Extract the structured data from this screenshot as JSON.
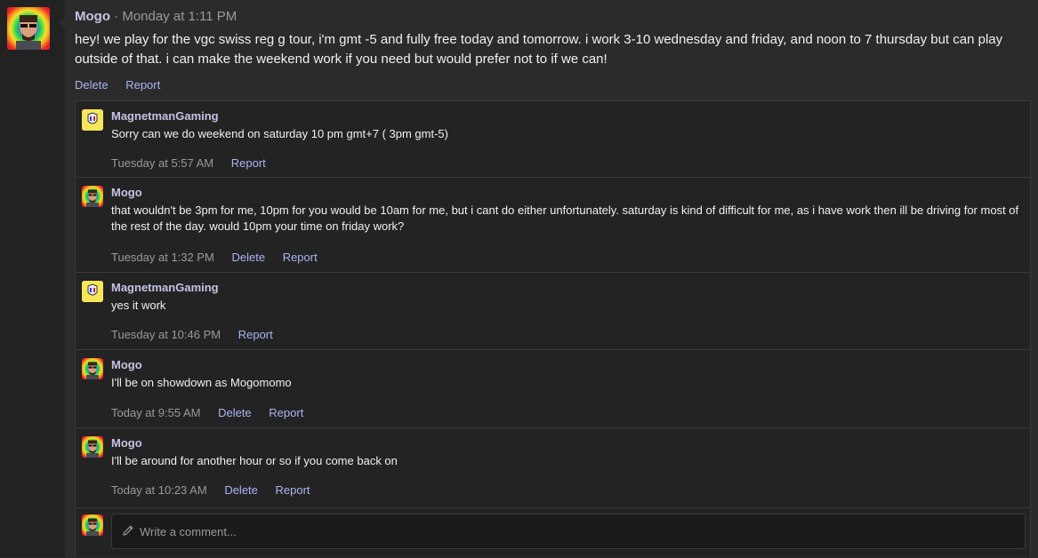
{
  "post": {
    "author": "Mogo",
    "meta": "· Monday at 1:11 PM",
    "body": "hey! we play for the vgc swiss reg g tour, i'm gmt -5 and fully free today and tomorrow. i work 3-10 wednesday and friday, and noon to 7 thursday but can play outside of that. i can make the weekend work if you need but would prefer not to if we can!",
    "actions": [
      "Delete",
      "Report"
    ]
  },
  "replies": [
    {
      "author": "MagnetmanGaming",
      "text": "Sorry can we do weekend on saturday 10 pm gmt+7 ( 3pm gmt-5)",
      "time": "Tuesday at 5:57 AM",
      "actions": [
        "Report"
      ]
    },
    {
      "author": "Mogo",
      "text": "that wouldn't be 3pm for me, 10pm for you would be 10am for me, but i cant do either unfortunately. saturday is kind of difficult for me, as i have work then ill be driving for most of the rest of the day. would 10pm your time on friday work?",
      "time": "Tuesday at 1:32 PM",
      "actions": [
        "Delete",
        "Report"
      ]
    },
    {
      "author": "MagnetmanGaming",
      "text": "yes it work",
      "time": "Tuesday at 10:46 PM",
      "actions": [
        "Report"
      ]
    },
    {
      "author": "Mogo",
      "text": "I'll be on showdown as Mogomomo",
      "time": "Today at 9:55 AM",
      "actions": [
        "Delete",
        "Report"
      ]
    },
    {
      "author": "Mogo",
      "text": "I'll be around for another hour or so if you come back on",
      "time": "Today at 10:23 AM",
      "actions": [
        "Delete",
        "Report"
      ]
    }
  ],
  "composer": {
    "placeholder": "Write a comment...",
    "icon": "pencil-icon"
  },
  "colors": {
    "background": "#2b2b2b",
    "author": "#c3c3e6",
    "link": "#a9b4f2",
    "magnetman_avatar": "#f7e65a"
  }
}
